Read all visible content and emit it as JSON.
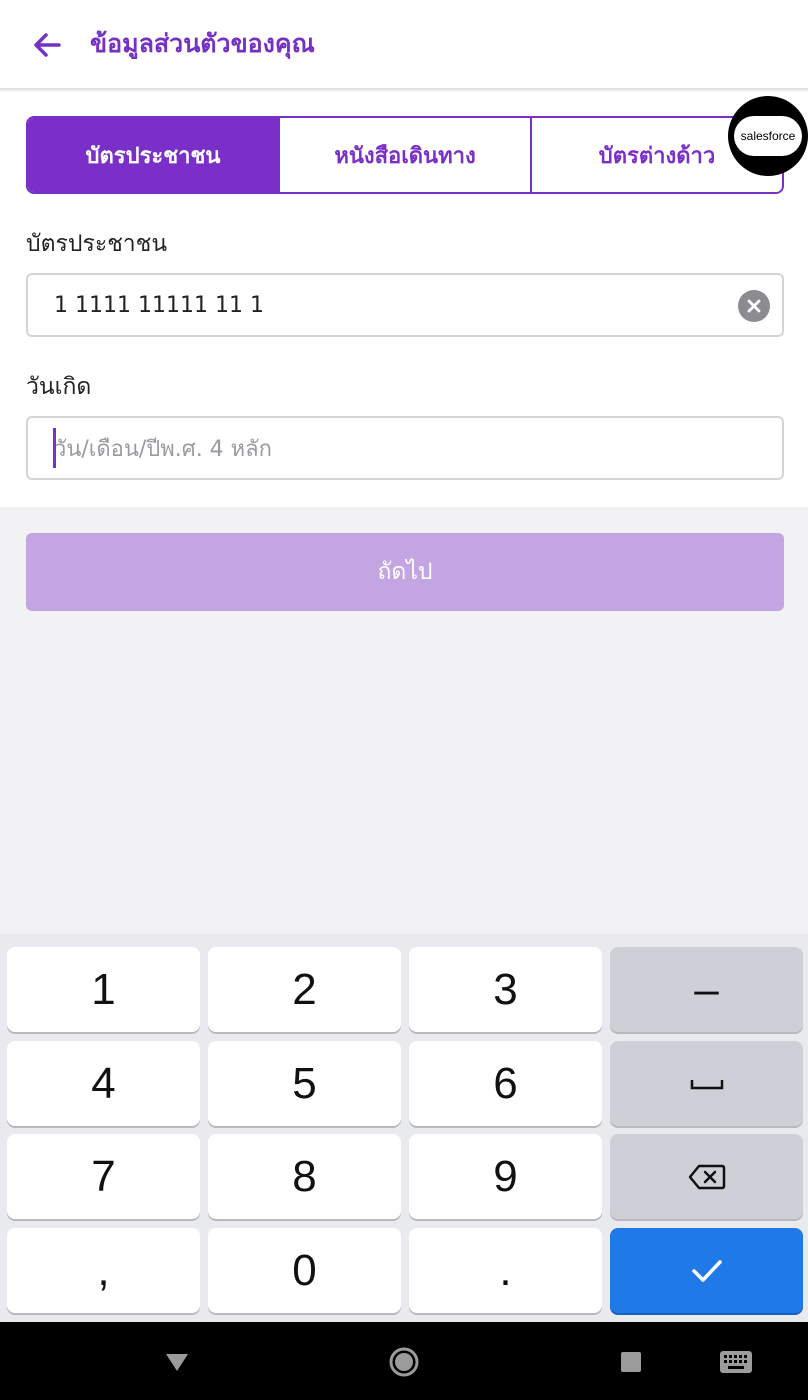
{
  "header": {
    "title": "ข้อมูลส่วนตัวของคุณ",
    "back_icon": "arrow-left-icon"
  },
  "tabs": [
    {
      "label": "บัตรประชาชน",
      "active": true
    },
    {
      "label": "หนังสือเดินทาง",
      "active": false
    },
    {
      "label": "บัตรต่างด้าว",
      "active": false
    }
  ],
  "badge": {
    "label": "salesforce"
  },
  "form": {
    "id_label": "บัตรประชาชน",
    "id_value": "1 1111 11111 11 1",
    "dob_label": "วันเกิด",
    "dob_placeholder": "วัน/เดือน/ปีพ.ศ. 4 หลัก",
    "dob_value": ""
  },
  "next_button": {
    "label": "ถัดไป"
  },
  "keyboard": {
    "rows": [
      [
        "1",
        "2",
        "3",
        "–"
      ],
      [
        "4",
        "5",
        "6",
        "space"
      ],
      [
        "7",
        "8",
        "9",
        "backspace"
      ],
      [
        ",",
        "0",
        ".",
        "done"
      ]
    ]
  },
  "colors": {
    "accent": "#7b2fc9",
    "next_disabled": "#c3a5e2",
    "done_key": "#1f7ae8"
  },
  "navbar": {
    "icons": [
      "back-triangle-icon",
      "home-circle-icon",
      "recents-square-icon",
      "keyboard-icon"
    ]
  }
}
